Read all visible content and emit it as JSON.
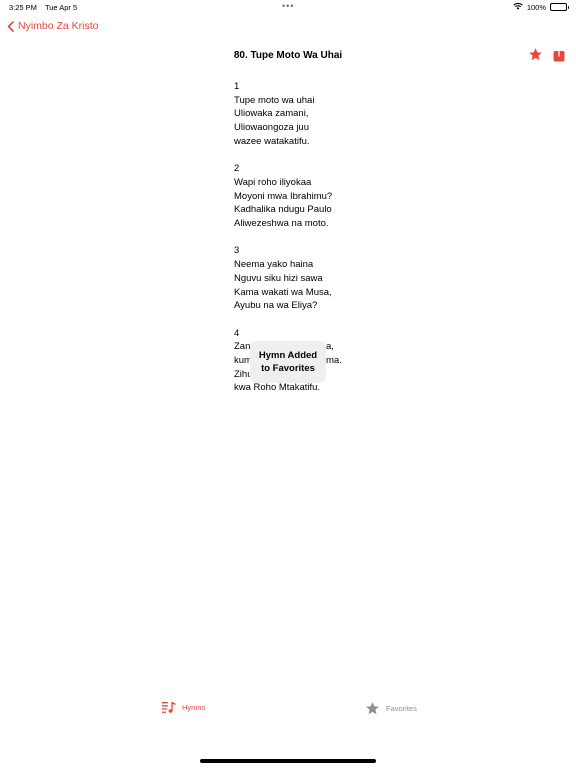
{
  "status_bar": {
    "time": "3:25 PM",
    "date": "Tue Apr 5",
    "multitask_dots": "•••",
    "battery_percent": "100%",
    "battery_level": 1.0
  },
  "nav": {
    "back_label": "Nyimbo Za Kristo",
    "title": "80. Tupe Moto Wa Uhai"
  },
  "hymn": {
    "verses": [
      {
        "number": "1",
        "lines": [
          "Tupe moto wa uhai",
          "Uliowaka zamani,",
          "Uliowaongoza juu",
          "wazee watakatifu."
        ]
      },
      {
        "number": "2",
        "lines": [
          "Wapi roho iliyokaa",
          "Moyoni mwa Ibrahimu?",
          "Kadhalika ndugu Paulo",
          "Aliwezeshwa na moto."
        ]
      },
      {
        "number": "3",
        "lines": [
          "Neema yako haina",
          "Nguvu siku hizi sawa",
          "Kama wakati wa Musa,",
          "Ayubu na wa Eliya?"
        ]
      },
      {
        "number": "4",
        "lines": [
          "Zan",
          "kum",
          "Zihu",
          "kwa Roho Mtakatifu."
        ]
      }
    ]
  },
  "toast": {
    "line1": "Hymn Added",
    "line2": "to Favorites"
  },
  "tabs": [
    {
      "label": "Hymns",
      "icon": "music-list-icon",
      "active": true
    },
    {
      "label": "Favorites",
      "icon": "star-icon",
      "active": false
    }
  ],
  "colors": {
    "accent": "#e8453c",
    "inactive": "#8e8e93"
  },
  "verse4_partial": {
    "line1_tail": "a,",
    "line2_tail": "ma."
  }
}
